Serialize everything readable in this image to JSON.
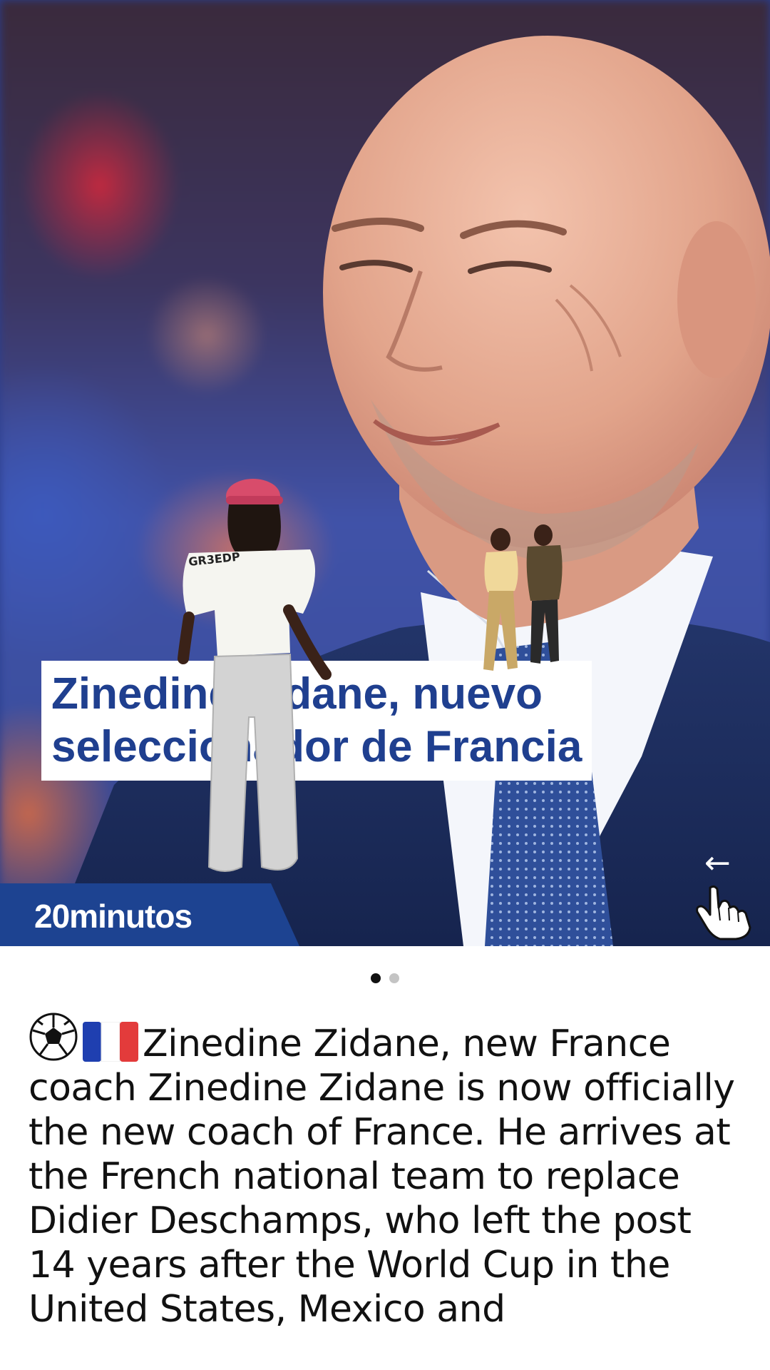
{
  "post": {
    "headline_line1": "Zinedine Zidane, nuevo",
    "headline_line2": "seleccionador de Francia",
    "brand": "20minutos",
    "swipe_arrow": "←",
    "carousel": {
      "total_slides": 2,
      "active_index": 0
    },
    "caption": {
      "emoji_icons": [
        "soccer-ball-icon",
        "france-flag-icon"
      ],
      "text": "Zinedine Zidane, new France coach Zinedine Zidane is now officially the new coach of France. He arrives at the French national team to replace Didier Deschamps, who left the post 14 years after the World Cup in the United States, Mexico and"
    }
  },
  "colors": {
    "brand_blue": "#1d4391",
    "headline_blue": "#1f3f8f",
    "caption_text": "#111111",
    "dot_active": "#111111",
    "dot_inactive": "#c4c4c4"
  }
}
